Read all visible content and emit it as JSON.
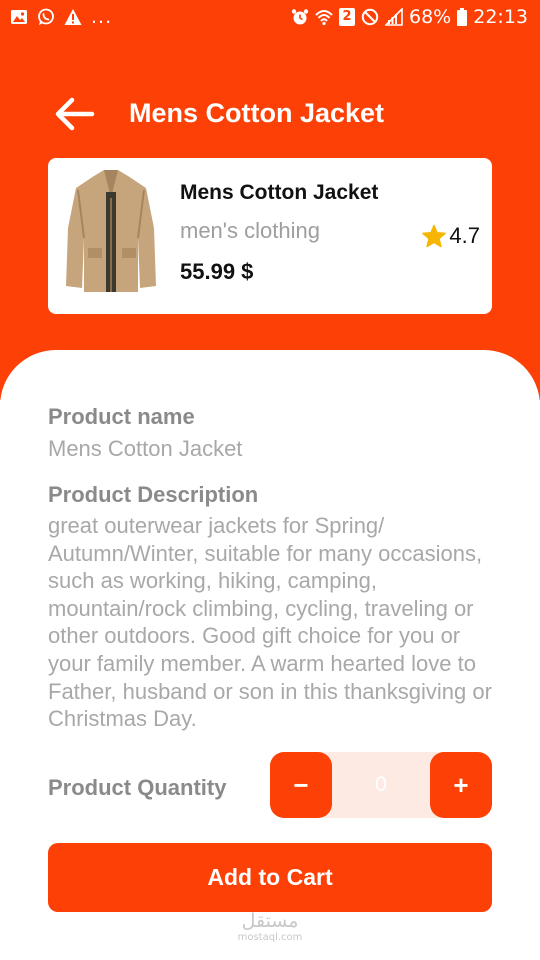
{
  "colors": {
    "accent": "#FD4006",
    "qty_bg": "#FDEBE3"
  },
  "status_bar": {
    "left_icons": [
      "image-icon",
      "whatsapp-icon",
      "warning-icon"
    ],
    "dots": "...",
    "right_icons": [
      "alarm-icon",
      "wifi-icon",
      "sim-2-icon",
      "blocked-icon",
      "signal-icon"
    ],
    "sim_label": "2",
    "battery": "68%",
    "battery_icon": "battery-icon",
    "time": "22:13"
  },
  "header": {
    "back_icon": "arrow-left-icon",
    "title": "Mens Cotton Jacket"
  },
  "product_card": {
    "image_icon": "jacket-image",
    "name": "Mens Cotton Jacket",
    "category": "men's clothing",
    "price": "55.99 $",
    "rating_icon": "star-icon",
    "rating": "4.7"
  },
  "details": {
    "name_label": "Product name",
    "name_value": "Mens Cotton Jacket",
    "description_label": "Product Description",
    "description": "great outerwear jackets for Spring/ Autumn/Winter, suitable for many occasions, such as working, hiking, camping, mountain/rock climbing, cycling, traveling or other outdoors. Good gift choice for you or your family member. A warm hearted love to Father, husband or son in this thanksgiving or Christmas Day."
  },
  "quantity": {
    "label": "Product Quantity",
    "minus": "−",
    "value": "0",
    "plus": "+"
  },
  "add_to_cart": "Add to Cart",
  "watermark": {
    "arabic": "مستقل",
    "latin": "mostaql.com"
  }
}
